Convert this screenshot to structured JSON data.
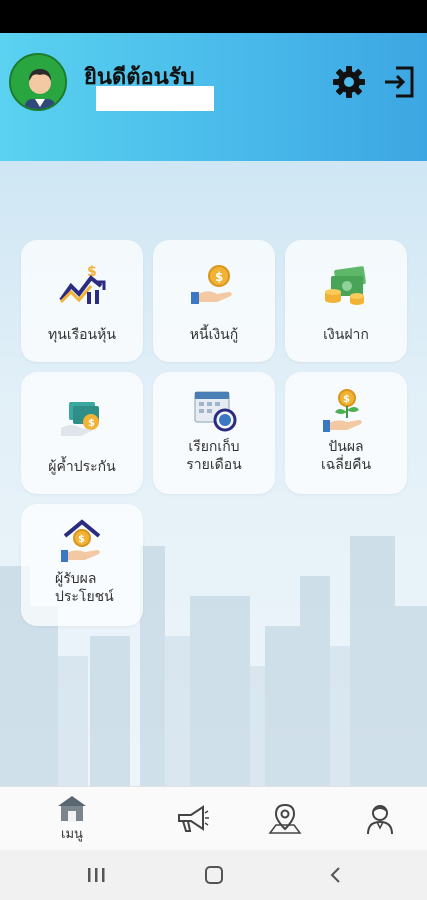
{
  "header": {
    "welcome_text": "ยินดีต้อนรับ",
    "username": "",
    "settings_icon": "gear-icon",
    "logout_icon": "logout-icon"
  },
  "menu": {
    "items": [
      {
        "label": "ทุนเรือนหุ้น",
        "icon": "stock-chart-icon"
      },
      {
        "label": "หนี้เงินกู้",
        "icon": "loan-coin-icon"
      },
      {
        "label": "เงินฝาก",
        "icon": "money-stack-icon"
      },
      {
        "label": "ผู้ค้ำประกัน",
        "icon": "guarantor-icon"
      },
      {
        "line1": "เรียกเก็บ",
        "line2": "รายเดือน",
        "icon": "calendar-coin-icon"
      },
      {
        "line1": "ปันผล",
        "line2": "เฉลี่ยคืน",
        "icon": "dividend-plant-icon"
      },
      {
        "line1": "ผู้รับผล",
        "line2": "ประโยชน์",
        "icon": "beneficiary-house-icon"
      }
    ]
  },
  "bottom_nav": {
    "home_label": "เมนู",
    "items": [
      "home-icon",
      "megaphone-icon",
      "map-pin-icon",
      "profile-icon"
    ]
  },
  "colors": {
    "header_start": "#5ad2f0",
    "header_end": "#3ca6e2",
    "coin": "#f2b233",
    "arrow_up": "#2b2b80"
  }
}
